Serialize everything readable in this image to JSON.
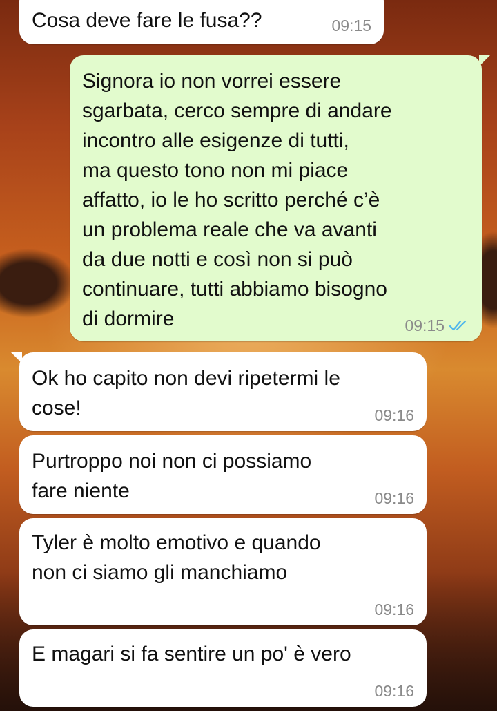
{
  "colors": {
    "incoming_bubble": "#ffffff",
    "outgoing_bubble": "#e2fbcd",
    "timestamp": "#8a8a8a",
    "read_ticks": "#4fb6ec"
  },
  "messages": [
    {
      "direction": "incoming",
      "text": "Cosa deve fare le fusa??",
      "time": "09:15"
    },
    {
      "direction": "outgoing",
      "text": "Signora io non vorrei essere\nsgarbata, cerco sempre di andare\nincontro alle esigenze di tutti,\nma questo tono non mi piace\naffatto, io le ho scritto perché c’è\nun problema reale che va avanti\nda due notti e così non si può\ncontinuare, tutti abbiamo bisogno\ndi dormire",
      "time": "09:15",
      "status_icon": "double-check-read-icon"
    },
    {
      "direction": "incoming",
      "text": "Ok ho capito non devi ripetermi le\ncose!",
      "time": "09:16"
    },
    {
      "direction": "incoming",
      "text": "Purtroppo noi non ci possiamo\nfare niente",
      "time": "09:16"
    },
    {
      "direction": "incoming",
      "text": "Tyler è molto emotivo e quando\nnon ci siamo gli manchiamo",
      "time": "09:16"
    },
    {
      "direction": "incoming",
      "text": "E magari si fa sentire un po' è vero",
      "time": "09:16"
    }
  ]
}
